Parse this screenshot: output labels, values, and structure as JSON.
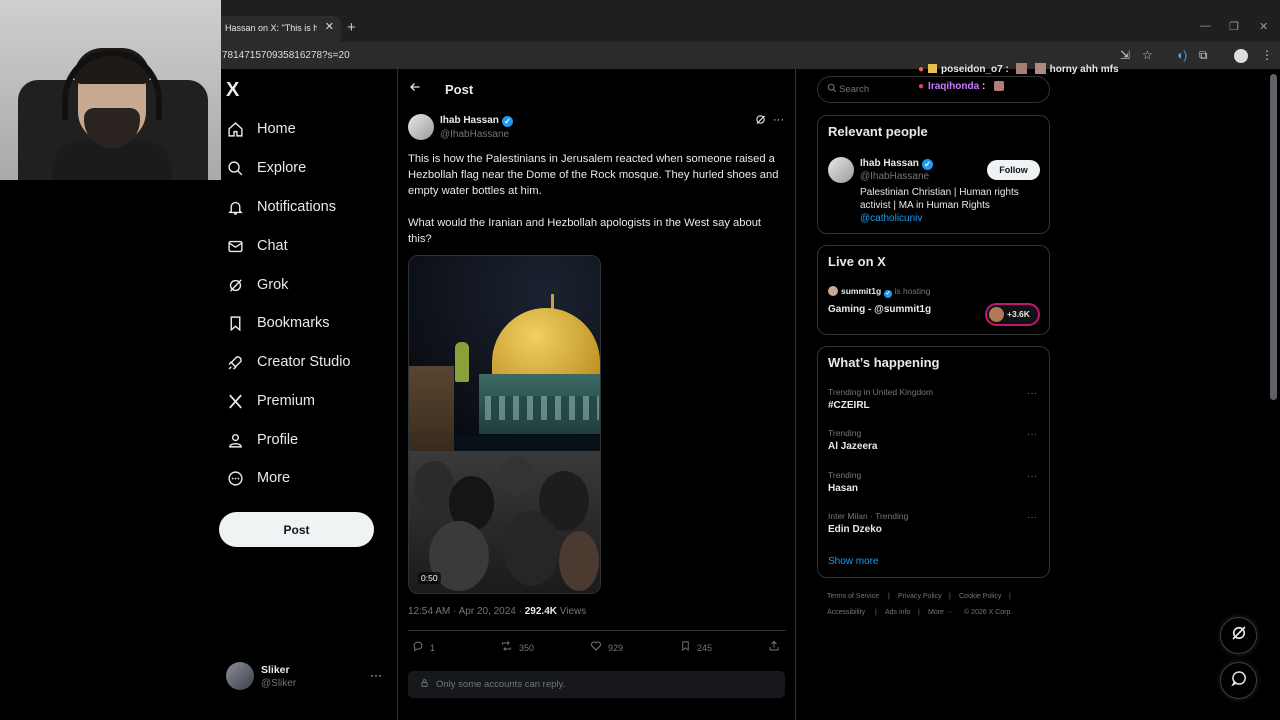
{
  "browser": {
    "tab_title": "Hassan on X: \"This is how t",
    "tab_close": "✕",
    "new_tab": "+",
    "url": "781471570935816278?s=20",
    "window_controls": [
      "—",
      "❐",
      "✕"
    ]
  },
  "nav": {
    "logo": "X",
    "items": [
      {
        "label": "Home",
        "icon": "home-icon"
      },
      {
        "label": "Explore",
        "icon": "search-icon"
      },
      {
        "label": "Notifications",
        "icon": "bell-icon"
      },
      {
        "label": "Chat",
        "icon": "mail-icon"
      },
      {
        "label": "Grok",
        "icon": "grok-icon"
      },
      {
        "label": "Bookmarks",
        "icon": "bookmark-icon"
      },
      {
        "label": "Creator Studio",
        "icon": "rocket-icon"
      },
      {
        "label": "Premium",
        "icon": "x-icon"
      },
      {
        "label": "Profile",
        "icon": "person-icon"
      },
      {
        "label": "More",
        "icon": "more-circle-icon"
      }
    ],
    "post_button": "Post",
    "account": {
      "name": "Sliker",
      "handle": "@Sliker",
      "more": "···"
    }
  },
  "post": {
    "heading": "Post",
    "author_name": "Ihab Hassan",
    "author_handle": "@IhabHassane",
    "verified_glyph": "✓",
    "text_p1": "This is how the Palestinians in Jerusalem reacted when someone raised a Hezbollah flag near the Dome of the Rock mosque. They hurled shoes and empty water bottles at him.",
    "text_p2": "What would the Iranian and Hezbollah apologists in the West say about this?",
    "video_duration": "0:50",
    "timestamp": "12:54 AM · Apr 20, 2024 · ",
    "views_count": "292.4K",
    "views_label": " Views",
    "actions": {
      "replies": "1",
      "reposts": "350",
      "likes": "929",
      "bookmarks": "245"
    },
    "reply_restriction": "Only some accounts can reply."
  },
  "sidebar": {
    "search_placeholder": "Search",
    "relevant": {
      "title": "Relevant people",
      "name": "Ihab Hassan",
      "handle": "@IhabHassane",
      "follow": "Follow",
      "bio": "Palestinian Christian | Human rights activist | MA in Human Rights ",
      "bio_link": "@catholicuniv"
    },
    "live": {
      "title": "Live on X",
      "host": "summit1g",
      "hosting": " is hosting",
      "stream_title": "Gaming - @summit1g",
      "listeners": "+3.6K"
    },
    "happening": {
      "title": "What’s happening",
      "trends": [
        {
          "context": "Trending in United Kingdom",
          "name": "#CZEIRL"
        },
        {
          "context": "Trending",
          "name": "Al Jazeera"
        },
        {
          "context": "Trending",
          "name": "Hasan"
        },
        {
          "context": "Inter Milan · Trending",
          "name": "Edin Dzeko"
        }
      ],
      "show_more": "Show more"
    },
    "footer": [
      "Terms of Service",
      "|",
      "Privacy Policy",
      "|",
      "Cookie Policy",
      "|",
      "Accessibility",
      "|",
      "Ads info",
      "|",
      "More ···",
      "© 2026 X Corp."
    ]
  },
  "chat_overlay": [
    {
      "user": "poseidon_o7",
      "sep": " :",
      "message": "horny ahh mfs",
      "user_color": "#e8e8e8"
    },
    {
      "user": "Iraqihonda",
      "sep": " :",
      "message": "",
      "user_color": "#c77dff"
    }
  ],
  "colors": {
    "accent": "#1d9bf0",
    "background": "#000000",
    "border": "#2f3336",
    "live_ring": "#c01770"
  }
}
